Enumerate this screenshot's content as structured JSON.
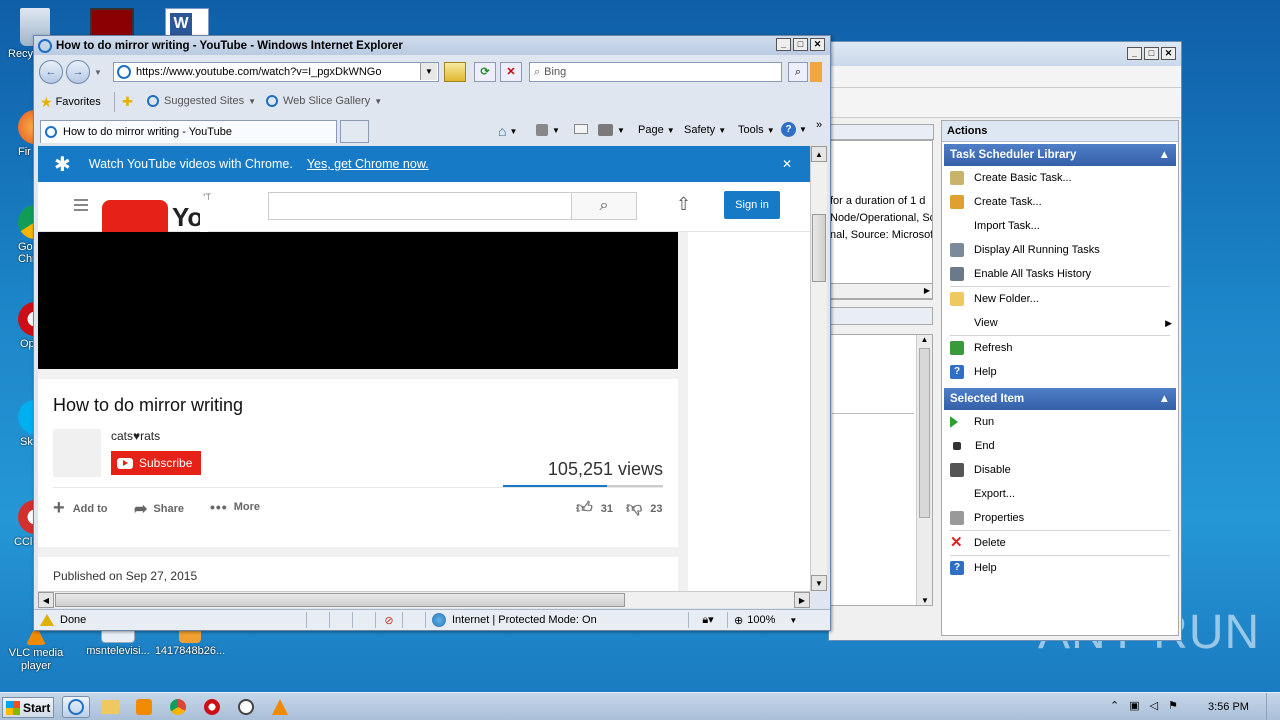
{
  "desktop": {
    "icons": [
      {
        "label": "Recy",
        "icon": "recycle-bin-icon"
      },
      {
        "label": "Fir",
        "icon": "firefox-icon"
      },
      {
        "label": "Go\nChr",
        "icon": "chrome-icon"
      },
      {
        "label": "Op",
        "icon": "opera-icon"
      },
      {
        "label": "Sk",
        "icon": "skype-icon"
      },
      {
        "label": "CCle",
        "icon": "ccleaner-icon"
      },
      {
        "label": "VLC media player",
        "icon": "vlc-icon"
      },
      {
        "label": "msntelevisi...",
        "icon": "document-icon"
      },
      {
        "label": "1417848b26...",
        "icon": "archive-icon"
      }
    ],
    "watermark": "ANY RUN"
  },
  "task_scheduler": {
    "actions_title": "Actions",
    "log_lines": [
      "for a duration of 1 d",
      "Node/Operational, So",
      "nal, Source: Microsof"
    ],
    "library_section": "Task Scheduler Library",
    "library_actions": [
      {
        "label": "Create Basic Task...",
        "icon": "create-basic-task-icon"
      },
      {
        "label": "Create Task...",
        "icon": "create-task-icon"
      },
      {
        "label": "Import Task...",
        "icon": ""
      },
      {
        "label": "Display All Running Tasks",
        "icon": "running-tasks-icon"
      },
      {
        "label": "Enable All Tasks History",
        "icon": "history-icon"
      },
      {
        "label": "New Folder...",
        "icon": "folder-icon"
      },
      {
        "label": "View",
        "icon": ""
      },
      {
        "label": "Refresh",
        "icon": "refresh-icon"
      },
      {
        "label": "Help",
        "icon": "help-icon"
      }
    ],
    "selected_section": "Selected Item",
    "selected_actions": [
      {
        "label": "Run",
        "icon": "run-icon"
      },
      {
        "label": "End",
        "icon": "end-icon"
      },
      {
        "label": "Disable",
        "icon": "disable-icon"
      },
      {
        "label": "Export...",
        "icon": ""
      },
      {
        "label": "Properties",
        "icon": "properties-icon"
      },
      {
        "label": "Delete",
        "icon": "delete-icon"
      },
      {
        "label": "Help",
        "icon": "help-icon"
      }
    ]
  },
  "ie": {
    "title": "How to do mirror writing - YouTube - Windows Internet Explorer",
    "url": "https://www.youtube.com/watch?v=I_pgxDkWNGo",
    "search_placeholder": "Bing",
    "favorites": "Favorites",
    "suggested_sites": "Suggested Sites",
    "web_slice_gallery": "Web Slice Gallery",
    "tab_title": "How to do mirror writing - YouTube",
    "commands": {
      "page": "Page",
      "safety": "Safety",
      "tools": "Tools"
    },
    "status": {
      "done": "Done",
      "zone": "Internet | Protected Mode: On",
      "zoom": "100%"
    }
  },
  "youtube": {
    "banner_text": "Watch YouTube videos with Chrome.",
    "banner_link": "Yes, get Chrome now.",
    "logo_region": "IT",
    "signin": "Sign in",
    "video_title": "How to do mirror writing",
    "channel": "cats♥rats",
    "subscribe": "Subscribe",
    "views": "105,251 views",
    "view_ratio": 0.65,
    "add_to": "Add to",
    "share": "Share",
    "more": "More",
    "likes": "31",
    "dislikes": "23",
    "published": "Published on Sep 27, 2015"
  },
  "taskbar": {
    "start": "Start",
    "time": "3:56 PM",
    "apps": [
      "ie-icon",
      "explorer-icon",
      "media-player-icon",
      "chrome-icon",
      "opera-icon",
      "clock-icon",
      "vlc-icon"
    ]
  }
}
